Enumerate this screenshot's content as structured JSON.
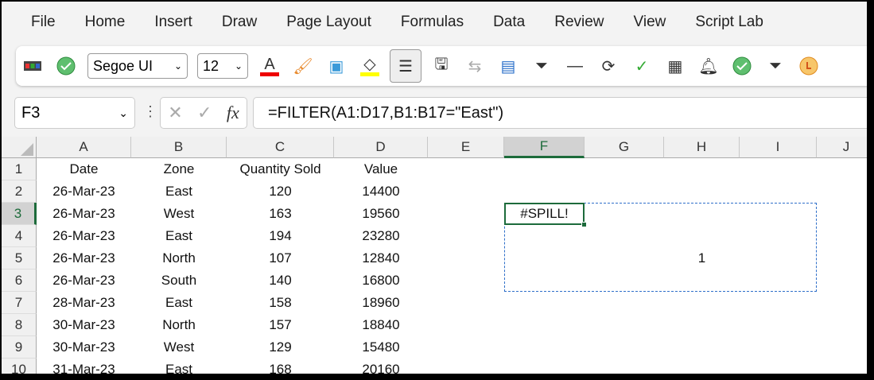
{
  "menu": [
    "File",
    "Home",
    "Insert",
    "Draw",
    "Page Layout",
    "Formulas",
    "Data",
    "Review",
    "View",
    "Script Lab"
  ],
  "toolbar": {
    "font": "Segoe UI",
    "size": "12",
    "icons": [
      "cells-icon",
      "check-circle-icon",
      "font-color-icon",
      "format-painter-icon",
      "3d-box-icon",
      "fill-color-icon",
      "align-center-icon",
      "save-edit-icon",
      "swap-icon",
      "clear-column-icon",
      "filter-icon",
      "line-icon",
      "refresh-icon",
      "checkmark-icon",
      "grid-icon",
      "bell-icon",
      "check-circle-icon",
      "filter-icon",
      "clock-icon"
    ]
  },
  "name_box": "F3",
  "formula": "=FILTER(A1:D17,B1:B17=\"East\")",
  "columns": [
    "A",
    "B",
    "C",
    "D",
    "E",
    "F",
    "G",
    "H",
    "I",
    "J"
  ],
  "selected_cell": "F3",
  "rows": [
    [
      "Date",
      "Zone",
      "Quantity Sold",
      "Value"
    ],
    [
      "26-Mar-23",
      "East",
      "120",
      "14400"
    ],
    [
      "26-Mar-23",
      "West",
      "163",
      "19560"
    ],
    [
      "26-Mar-23",
      "East",
      "194",
      "23280"
    ],
    [
      "26-Mar-23",
      "North",
      "107",
      "12840"
    ],
    [
      "26-Mar-23",
      "South",
      "140",
      "16800"
    ],
    [
      "28-Mar-23",
      "East",
      "158",
      "18960"
    ],
    [
      "30-Mar-23",
      "North",
      "157",
      "18840"
    ],
    [
      "30-Mar-23",
      "West",
      "129",
      "15480"
    ],
    [
      "31-Mar-23",
      "East",
      "168",
      "20160"
    ]
  ],
  "spill_value": "#SPILL!",
  "blocking_value": "1",
  "colors": {
    "accent": "#1d6b3b",
    "spill_border": "#2f6fc9"
  }
}
